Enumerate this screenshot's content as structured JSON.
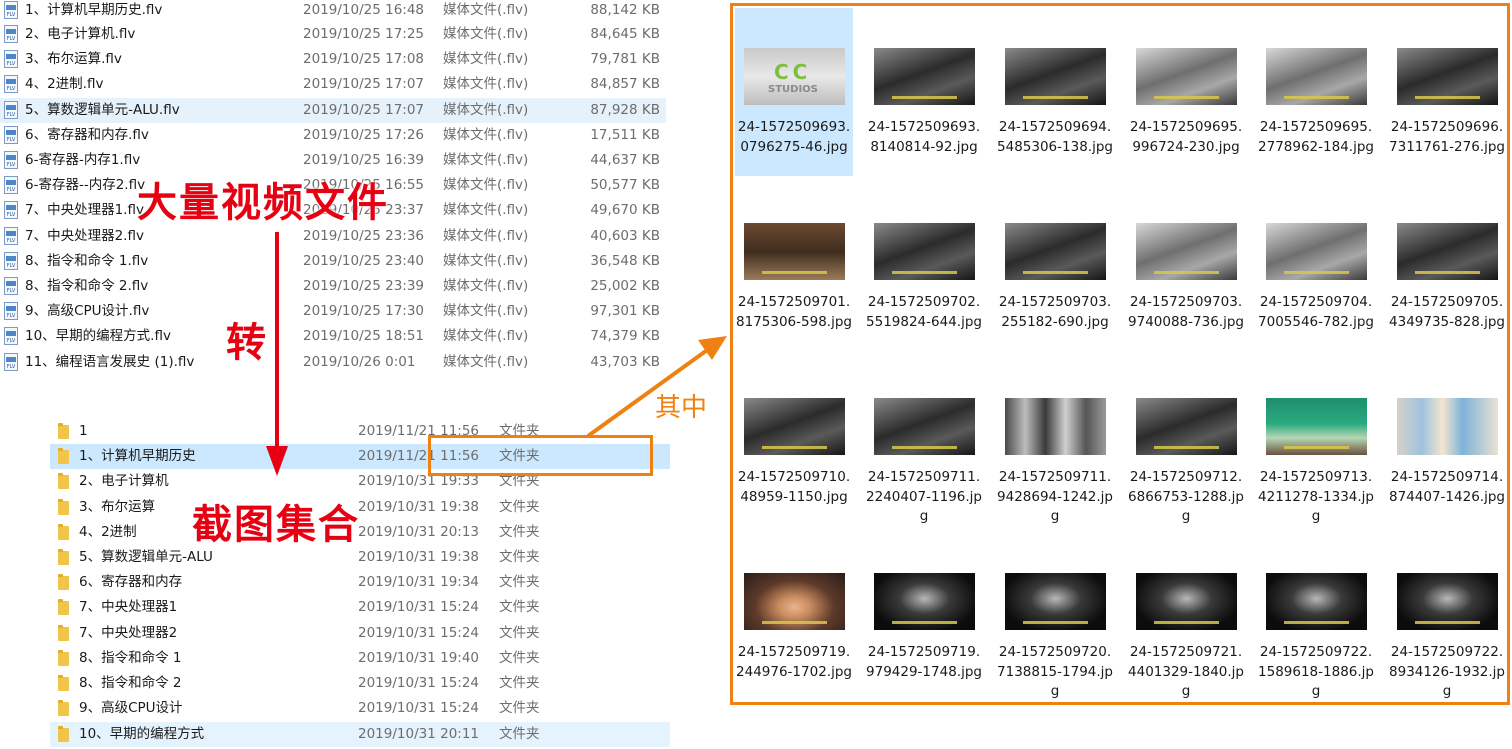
{
  "video_list": [
    {
      "name": "1、计算机早期历史.flv",
      "date": "2019/10/25 16:48",
      "type": "媒体文件(.flv)",
      "size": "88,142 KB"
    },
    {
      "name": "2、电子计算机.flv",
      "date": "2019/10/25 17:25",
      "type": "媒体文件(.flv)",
      "size": "84,645 KB"
    },
    {
      "name": "3、布尔运算.flv",
      "date": "2019/10/25 17:08",
      "type": "媒体文件(.flv)",
      "size": "79,781 KB"
    },
    {
      "name": "4、2进制.flv",
      "date": "2019/10/25 17:07",
      "type": "媒体文件(.flv)",
      "size": "84,857 KB"
    },
    {
      "name": "5、算数逻辑单元-ALU.flv",
      "date": "2019/10/25 17:07",
      "type": "媒体文件(.flv)",
      "size": "87,928 KB"
    },
    {
      "name": "6、寄存器和内存.flv",
      "date": "2019/10/25 17:26",
      "type": "媒体文件(.flv)",
      "size": "17,511 KB"
    },
    {
      "name": "6-寄存器-内存1.flv",
      "date": "2019/10/25 16:39",
      "type": "媒体文件(.flv)",
      "size": "44,637 KB"
    },
    {
      "name": "6-寄存器--内存2.flv",
      "date": "2019/10/25 16:55",
      "type": "媒体文件(.flv)",
      "size": "50,577 KB"
    },
    {
      "name": "7、中央处理器1.flv",
      "date": "2019/10/25 23:37",
      "type": "媒体文件(.flv)",
      "size": "49,670 KB"
    },
    {
      "name": "7、中央处理器2.flv",
      "date": "2019/10/25 23:36",
      "type": "媒体文件(.flv)",
      "size": "40,603 KB"
    },
    {
      "name": "8、指令和命令 1.flv",
      "date": "2019/10/25 23:40",
      "type": "媒体文件(.flv)",
      "size": "36,548 KB"
    },
    {
      "name": "8、指令和命令 2.flv",
      "date": "2019/10/25 23:39",
      "type": "媒体文件(.flv)",
      "size": "25,002 KB"
    },
    {
      "name": "9、高级CPU设计.flv",
      "date": "2019/10/25 17:30",
      "type": "媒体文件(.flv)",
      "size": "97,301 KB"
    },
    {
      "name": "10、早期的编程方式.flv",
      "date": "2019/10/25 18:51",
      "type": "媒体文件(.flv)",
      "size": "74,379 KB"
    },
    {
      "name": "11、编程语言发展史 (1).flv",
      "date": "2019/10/26 0:01",
      "type": "媒体文件(.flv)",
      "size": "43,703 KB"
    }
  ],
  "folder_list": [
    {
      "name": "1",
      "date": "2019/11/21 11:56",
      "type": "文件夹"
    },
    {
      "name": "1、计算机早期历史",
      "date": "2019/11/21 11:56",
      "type": "文件夹"
    },
    {
      "name": "2、电子计算机",
      "date": "2019/10/31 19:33",
      "type": "文件夹"
    },
    {
      "name": "3、布尔运算",
      "date": "2019/10/31 19:38",
      "type": "文件夹"
    },
    {
      "name": "4、2进制",
      "date": "2019/10/31 20:13",
      "type": "文件夹"
    },
    {
      "name": "5、算数逻辑单元-ALU",
      "date": "2019/10/31 19:38",
      "type": "文件夹"
    },
    {
      "name": "6、寄存器和内存",
      "date": "2019/10/31 19:34",
      "type": "文件夹"
    },
    {
      "name": "7、中央处理器1",
      "date": "2019/10/31 15:24",
      "type": "文件夹"
    },
    {
      "name": "7、中央处理器2",
      "date": "2019/10/31 15:24",
      "type": "文件夹"
    },
    {
      "name": "8、指令和命令 1",
      "date": "2019/10/31 19:40",
      "type": "文件夹"
    },
    {
      "name": "8、指令和命令 2",
      "date": "2019/10/31 15:24",
      "type": "文件夹"
    },
    {
      "name": "9、高级CPU设计",
      "date": "2019/10/31 15:24",
      "type": "文件夹"
    },
    {
      "name": "10、早期的编程方式",
      "date": "2019/10/31 20:11",
      "type": "文件夹"
    }
  ],
  "annotations": {
    "many_videos": "大量视频文件",
    "convert": "转",
    "screenshot_collection": "截图集合",
    "among": "其中"
  },
  "thumbnails": [
    {
      "name": "24-1572509693.0796275-46.jpg"
    },
    {
      "name": "24-1572509693.8140814-92.jpg"
    },
    {
      "name": "24-1572509694.5485306-138.jpg"
    },
    {
      "name": "24-1572509695.996724-230.jpg"
    },
    {
      "name": "24-1572509695.2778962-184.jpg"
    },
    {
      "name": "24-1572509696.7311761-276.jpg"
    },
    {
      "name": "24-1572509701.8175306-598.jpg"
    },
    {
      "name": "24-1572509702.5519824-644.jpg"
    },
    {
      "name": "24-1572509703.255182-690.jpg"
    },
    {
      "name": "24-1572509703.9740088-736.jpg"
    },
    {
      "name": "24-1572509704.7005546-782.jpg"
    },
    {
      "name": "24-1572509705.4349735-828.jpg"
    },
    {
      "name": "24-1572509710.48959-1150.jpg"
    },
    {
      "name": "24-1572509711.2240407-1196.jpg"
    },
    {
      "name": "24-1572509711.9428694-1242.jpg"
    },
    {
      "name": "24-1572509712.6866753-1288.jpg"
    },
    {
      "name": "24-1572509713.4211278-1334.jpg"
    },
    {
      "name": "24-1572509714.874407-1426.jpg"
    },
    {
      "name": "24-1572509719.244976-1702.jpg"
    },
    {
      "name": "24-1572509719.979429-1748.jpg"
    },
    {
      "name": "24-1572509720.7138815-1794.jpg"
    },
    {
      "name": "24-1572509721.4401329-1840.jpg"
    },
    {
      "name": "24-1572509722.1589618-1886.jpg"
    },
    {
      "name": "24-1572509722.8934126-1932.jpg"
    }
  ],
  "colors": {
    "annotation_red": "#e60012",
    "annotation_orange": "#ee8111",
    "selection_blue": "#cce8ff",
    "hover_blue": "#e5f1fb"
  }
}
